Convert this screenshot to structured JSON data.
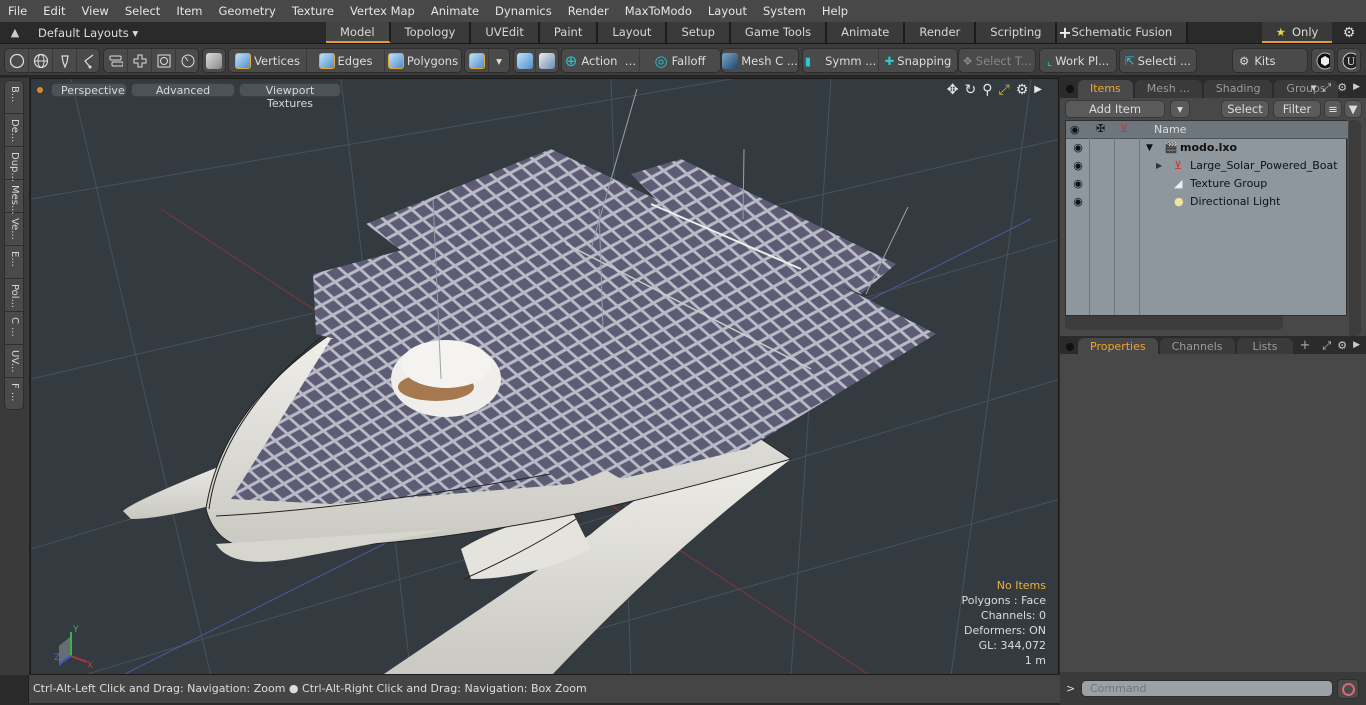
{
  "menu": [
    "File",
    "Edit",
    "View",
    "Select",
    "Item",
    "Geometry",
    "Texture",
    "Vertex Map",
    "Animate",
    "Dynamics",
    "Render",
    "MaxToModo",
    "Layout",
    "System",
    "Help"
  ],
  "layoutbar": {
    "layouts_label": "Default Layouts",
    "tabs": [
      "Model",
      "Topology",
      "UVEdit",
      "Paint",
      "Layout",
      "Setup",
      "Game Tools",
      "Animate",
      "Render",
      "Scripting",
      "Schematic Fusion"
    ],
    "active_tab": "Model",
    "add_tab": "+",
    "only_label": "Only"
  },
  "toolbar": {
    "vertices": "Vertices",
    "edges": "Edges",
    "polygons": "Polygons",
    "action": "Action",
    "falloff": "Falloff",
    "mesh_c": "Mesh C ...",
    "symm": "Symm ...",
    "snapping": "Snapping",
    "select_t": "Select T...",
    "work_pl": "Work Pl...",
    "selecti": "Selecti ...",
    "kits": "Kits"
  },
  "left_tabs": [
    "B...",
    "De...",
    "Dup...",
    "Mes...",
    "Ve...",
    "E...",
    "Pol...",
    "C ...",
    "UV...",
    "F ..."
  ],
  "viewport": {
    "view_mode": "Perspective",
    "shading": "Advanced",
    "textures": "Viewport Textures",
    "stats": {
      "selection": "No Items",
      "polygons": "Polygons : Face",
      "channels": "Channels: 0",
      "deformers": "Deformers: ON",
      "gl": "GL: 344,072",
      "scale": "1 m"
    },
    "axes": {
      "x": "X",
      "y": "Y",
      "z": "Z"
    },
    "colors": {
      "background": "#333b41",
      "accent": "#f0b03a"
    }
  },
  "status": {
    "hint_left": "Ctrl-Alt-Left Click and Drag: Navigation: Zoom",
    "hint_right": "Ctrl-Alt-Right Click and Drag: Navigation: Box Zoom"
  },
  "items_panel": {
    "tabs": [
      "Items",
      "Mesh ...",
      "Shading",
      "Groups"
    ],
    "active_tab": "Items",
    "add_item": "Add Item",
    "select": "Select",
    "filter": "Filter",
    "column_name": "Name",
    "rows": [
      {
        "name": "modo.lxo",
        "icon": "scene-icon",
        "level": 0,
        "expanded": true
      },
      {
        "name": "Large_Solar_Powered_Boat",
        "icon": "mesh-locator-icon",
        "level": 1,
        "expanded": false
      },
      {
        "name": "Texture Group",
        "icon": "texture-group-icon",
        "level": 1
      },
      {
        "name": "Directional Light",
        "icon": "light-icon",
        "level": 1
      }
    ]
  },
  "properties_panel": {
    "tabs": [
      "Properties",
      "Channels",
      "Lists"
    ],
    "active_tab": "Properties",
    "add_tab": "+"
  },
  "command": {
    "placeholder": "Command",
    "prompt": ">"
  }
}
